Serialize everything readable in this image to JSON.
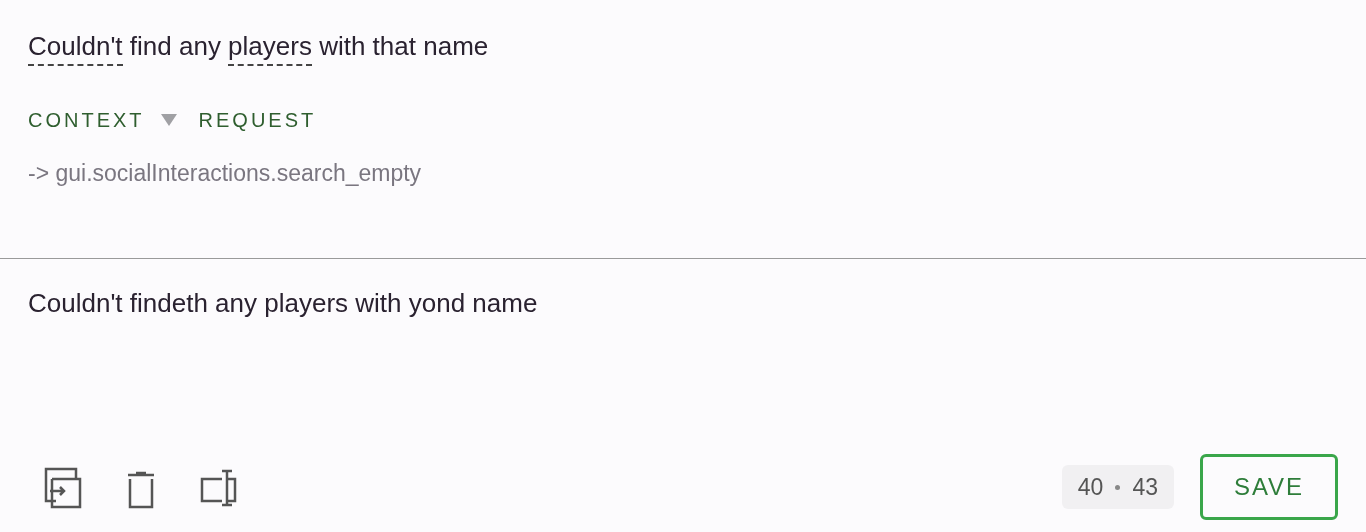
{
  "source": {
    "segments": [
      {
        "text": "Couldn't",
        "glossary": true
      },
      {
        "text": " find any ",
        "glossary": false
      },
      {
        "text": "players",
        "glossary": true
      },
      {
        "text": " with that name",
        "glossary": false
      }
    ]
  },
  "meta_tabs": [
    {
      "label": "CONTEXT",
      "expanded": true
    },
    {
      "label": "REQUEST"
    }
  ],
  "context_key": "-> gui.socialInteractions.search_empty",
  "translation": {
    "value": "Couldn't findeth any players with yond name"
  },
  "toolbar": [
    {
      "kind": "copy"
    },
    {
      "kind": "delete"
    },
    {
      "kind": "insert"
    }
  ],
  "counter": {
    "current": "40",
    "total": "43"
  },
  "save_button": "SAVE"
}
